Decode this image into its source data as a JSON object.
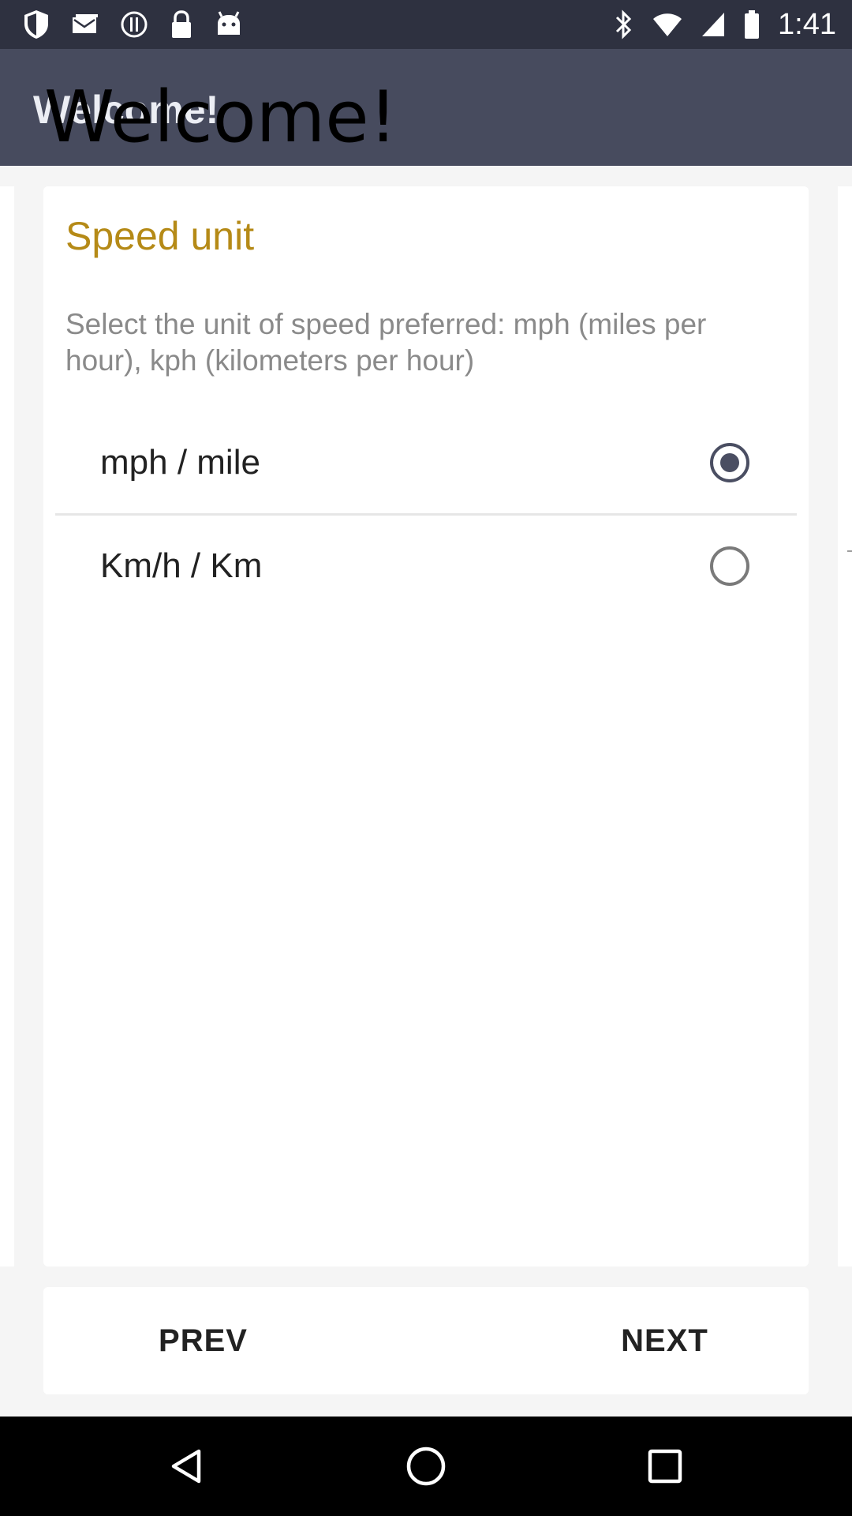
{
  "status_bar": {
    "time": "1:41",
    "left_icons": [
      "shield-icon",
      "mail-icon",
      "info-icon",
      "lock-icon",
      "android-icon"
    ],
    "right_icons": [
      "bluetooth-icon",
      "wifi-icon",
      "signal-icon",
      "battery-icon"
    ]
  },
  "app_bar": {
    "title": "Welcome!",
    "title_overlay": "Welcome!"
  },
  "card": {
    "title": "Speed unit",
    "description": "Select the unit of speed preferred: mph (miles per hour), kph (kilometers per hour)",
    "options": [
      {
        "label": "mph / mile",
        "selected": true
      },
      {
        "label": "Km/h / Km",
        "selected": false
      }
    ]
  },
  "buttons": {
    "prev_label": "PREV",
    "next_label": "NEXT"
  },
  "nav_bar": {
    "items": [
      "back-icon",
      "home-icon",
      "recents-icon"
    ]
  },
  "colors": {
    "status_bar": "#2e3140",
    "app_bar": "#474b5e",
    "accent_title": "#b58a17",
    "radio": "#4a4e62"
  }
}
